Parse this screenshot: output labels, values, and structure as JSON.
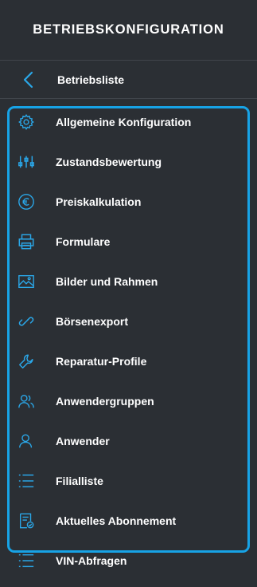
{
  "header": {
    "title": "BETRIEBSKONFIGURATION"
  },
  "back": {
    "label": "Betriebsliste",
    "icon": "chevron-left-icon"
  },
  "accent_color": "#17a3e6",
  "icon_color": "#2aa7e8",
  "menu": {
    "items": [
      {
        "label": "Allgemeine Konfiguration",
        "icon": "gear-icon"
      },
      {
        "label": "Zustandsbewertung",
        "icon": "sliders-icon"
      },
      {
        "label": "Preiskalkulation",
        "icon": "euro-icon"
      },
      {
        "label": "Formulare",
        "icon": "printer-icon"
      },
      {
        "label": "Bilder und Rahmen",
        "icon": "image-icon"
      },
      {
        "label": "Börsenexport",
        "icon": "link-icon"
      },
      {
        "label": "Reparatur-Profile",
        "icon": "wrench-icon"
      },
      {
        "label": "Anwendergruppen",
        "icon": "users-icon"
      },
      {
        "label": "Anwender",
        "icon": "user-icon"
      },
      {
        "label": "Filialliste",
        "icon": "list-icon"
      },
      {
        "label": "Aktuelles Abonnement",
        "icon": "subscription-icon"
      },
      {
        "label": "VIN-Abfragen",
        "icon": "list-icon"
      }
    ]
  }
}
